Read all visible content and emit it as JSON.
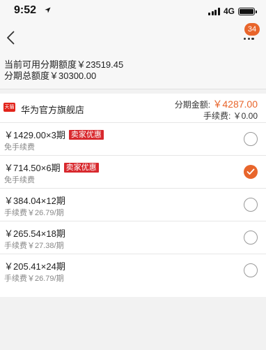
{
  "status_bar": {
    "time": "9:52",
    "network": "4G"
  },
  "header": {
    "badge_count": "34"
  },
  "quota": {
    "available": "当前可用分期额度￥23519.45",
    "total": "分期总额度￥30300.00"
  },
  "store": {
    "logo_text": "天猫",
    "name": "华为官方旗舰店",
    "amount_label": "分期金额: ",
    "amount_value": "￥4287.00",
    "fee_summary": "手续费: ￥0.00"
  },
  "plans": [
    {
      "main": "￥1429.00×3期",
      "promo": "卖家优惠",
      "sub": "免手续费",
      "selected": false
    },
    {
      "main": "￥714.50×6期",
      "promo": "卖家优惠",
      "sub": "免手续费",
      "selected": true
    },
    {
      "main": "￥384.04×12期",
      "promo": "",
      "sub": "手续费￥26.79/期",
      "selected": false
    },
    {
      "main": "￥265.54×18期",
      "promo": "",
      "sub": "手续费￥27.38/期",
      "selected": false
    },
    {
      "main": "￥205.41×24期",
      "promo": "",
      "sub": "手续费￥26.79/期",
      "selected": false
    }
  ],
  "colors": {
    "accent": "#e8652b",
    "promo": "#d8282d",
    "background": "#f2f2f2"
  }
}
